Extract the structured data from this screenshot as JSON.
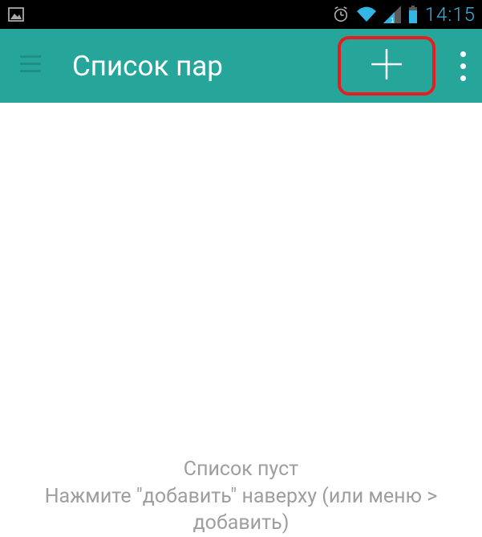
{
  "status_bar": {
    "time": "14:15",
    "icons": {
      "left_image": "image-icon",
      "alarm": "alarm-icon",
      "wifi": "wifi-icon",
      "signal": "signal-icon",
      "battery": "battery-icon"
    }
  },
  "app_bar": {
    "title": "Список пар",
    "colors": {
      "bg": "#26a69a",
      "highlight": "#e81c1c"
    }
  },
  "content": {
    "empty_line1": "Список пуст",
    "empty_line2": "Нажмите \"добавить\" наверху (или меню > добавить)"
  }
}
